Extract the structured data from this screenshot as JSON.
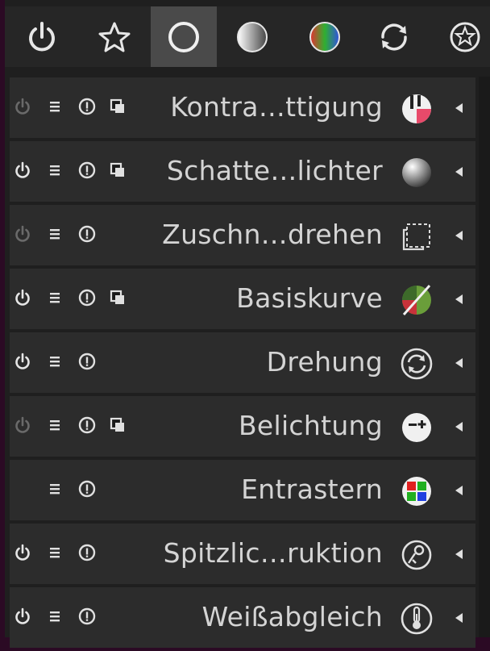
{
  "tabs": [
    {
      "name": "power-icon",
      "active": false
    },
    {
      "name": "star-icon",
      "active": false
    },
    {
      "name": "circle-outline-icon",
      "active": true
    },
    {
      "name": "gradient-sphere-icon",
      "active": false
    },
    {
      "name": "color-wheel-icon",
      "active": false
    },
    {
      "name": "refresh-cycle-icon",
      "active": false
    },
    {
      "name": "effects-icon",
      "active": false
    }
  ],
  "modules": [
    {
      "label": "Kontra…ttigung",
      "power": "dim",
      "multi": true,
      "icon": "contrast-saturation-icon"
    },
    {
      "label": "Schatte…lichter",
      "power": "on",
      "multi": true,
      "icon": "shadows-highlights-icon"
    },
    {
      "label": "Zuschn…drehen",
      "power": "dim",
      "multi": false,
      "icon": "crop-rotate-icon"
    },
    {
      "label": "Basiskurve",
      "power": "on",
      "multi": true,
      "icon": "base-curve-icon"
    },
    {
      "label": "Drehung",
      "power": "on",
      "multi": false,
      "icon": "rotate-icon"
    },
    {
      "label": "Belichtung",
      "power": "dim",
      "multi": true,
      "icon": "exposure-icon"
    },
    {
      "label": "Entrastern",
      "power": "none",
      "multi": false,
      "icon": "demosaic-icon"
    },
    {
      "label": "Spitzlic…ruktion",
      "power": "on",
      "multi": false,
      "icon": "highlight-reconstruction-icon"
    },
    {
      "label": "Weißabgleich",
      "power": "on",
      "multi": false,
      "icon": "white-balance-icon"
    }
  ],
  "colors": {
    "panel": "#1f1f1f",
    "row": "#2c2c2c",
    "text": "#d4d4d4",
    "dim": "#6a6a6a",
    "active_tab": "#4a4a4a"
  }
}
